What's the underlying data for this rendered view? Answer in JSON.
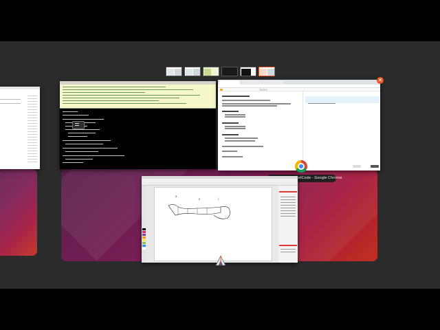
{
  "overview": {
    "workspaces": [
      {
        "id": "ws-1",
        "style": "light",
        "active": false
      },
      {
        "id": "ws-2",
        "style": "light",
        "active": false
      },
      {
        "id": "ws-3",
        "style": "green",
        "active": false
      },
      {
        "id": "ws-4",
        "style": "dark",
        "active": false
      },
      {
        "id": "ws-5",
        "style": "light",
        "active": false
      },
      {
        "id": "ws-6",
        "style": "light",
        "active": true
      }
    ],
    "hovered_window_label": "Sort an Array - LeetCode - Google Chrome",
    "close_symbol": "✕"
  },
  "colors": {
    "accent": "#e95420",
    "overview_bg": "#2b2b2b",
    "wallpaper_from": "#5a1f4e",
    "wallpaper_to": "#c1311f"
  },
  "icons": {
    "chrome": "chrome-icon",
    "terminal": "terminal-icon",
    "paint": "paint-app-icon",
    "close": "close-icon"
  }
}
